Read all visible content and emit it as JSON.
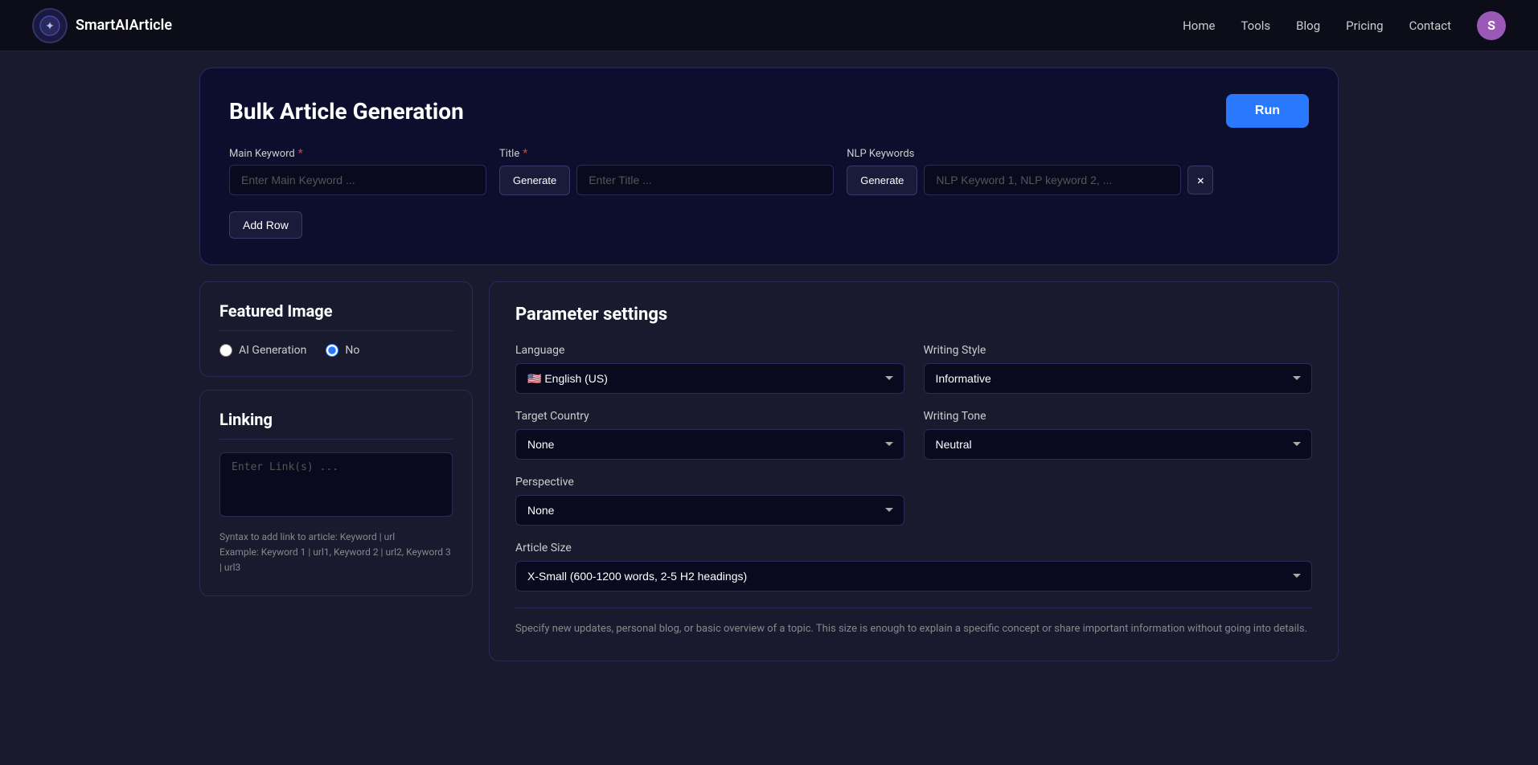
{
  "app": {
    "name": "SmartAIArticle",
    "logo_char": "✦"
  },
  "navbar": {
    "links": [
      {
        "id": "home",
        "label": "Home"
      },
      {
        "id": "tools",
        "label": "Tools"
      },
      {
        "id": "blog",
        "label": "Blog"
      },
      {
        "id": "pricing",
        "label": "Pricing"
      },
      {
        "id": "contact",
        "label": "Contact"
      }
    ],
    "user_initial": "S"
  },
  "bulk_card": {
    "title": "Bulk Article Generation",
    "run_button": "Run",
    "main_keyword": {
      "label": "Main Keyword",
      "placeholder": "Enter Main Keyword ..."
    },
    "title_field": {
      "label": "Title",
      "generate_button": "Generate",
      "placeholder": "Enter Title ..."
    },
    "nlp_keywords": {
      "label": "NLP Keywords",
      "generate_button": "Generate",
      "placeholder": "NLP Keyword 1, NLP keyword 2, ..."
    },
    "add_row_button": "Add Row"
  },
  "featured_image": {
    "title": "Featured Image",
    "options": [
      {
        "id": "ai_generation",
        "label": "AI Generation",
        "checked": false
      },
      {
        "id": "no",
        "label": "No",
        "checked": true
      }
    ]
  },
  "linking": {
    "title": "Linking",
    "placeholder": "Enter Link(s) ...",
    "syntax_note": "Syntax to add link to article: Keyword | url",
    "example": "Example: Keyword 1 | url1, Keyword 2 | url2, Keyword 3 | url3"
  },
  "parameter_settings": {
    "title": "Parameter settings",
    "language": {
      "label": "Language",
      "options": [
        {
          "value": "en_us",
          "label": "🇺🇸 English (US)"
        }
      ],
      "selected": "en_us"
    },
    "writing_style": {
      "label": "Writing Style",
      "options": [
        {
          "value": "informative",
          "label": "Informative"
        }
      ],
      "selected": "informative"
    },
    "target_country": {
      "label": "Target Country",
      "options": [
        {
          "value": "none",
          "label": "None"
        }
      ],
      "selected": "none"
    },
    "writing_tone": {
      "label": "Writing Tone",
      "options": [
        {
          "value": "neutral",
          "label": "Neutral"
        }
      ],
      "selected": "neutral"
    },
    "perspective": {
      "label": "Perspective",
      "options": [
        {
          "value": "none",
          "label": "None"
        }
      ],
      "selected": "none"
    },
    "article_size": {
      "label": "Article Size",
      "options": [
        {
          "value": "x_small",
          "label": "X-Small (600-1200 words, 2-5 H2 headings)"
        }
      ],
      "selected": "x_small",
      "note": "Specify new updates, personal blog, or basic overview of a topic. This size is enough to explain a specific concept or share important information without going into details."
    }
  }
}
